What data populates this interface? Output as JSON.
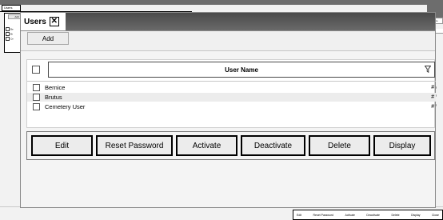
{
  "background_window": {
    "tab_label": "Users",
    "inner_button": "Add",
    "inner_rows": [
      "Be",
      "Br",
      "Ce"
    ],
    "right_field_text": "Suit Here",
    "footer_buttons": [
      "Edit",
      "Reset Password",
      "Activate",
      "Deactivate",
      "Delete",
      "Display",
      "Close"
    ]
  },
  "window": {
    "tab_title": "Users",
    "close_glyph": "✕"
  },
  "toolbar": {
    "add_label": "Add"
  },
  "grid": {
    "column_header": "User Name",
    "filter_icon": "filter-icon",
    "rows": [
      {
        "name": "Bernice"
      },
      {
        "name": "Brutus"
      },
      {
        "name": "Cemetery User"
      }
    ],
    "row_mark": "#"
  },
  "actions": {
    "edit": "Edit",
    "reset_password": "Reset Password",
    "activate": "Activate",
    "deactivate": "Deactivate",
    "delete": "Delete",
    "display": "Display"
  }
}
